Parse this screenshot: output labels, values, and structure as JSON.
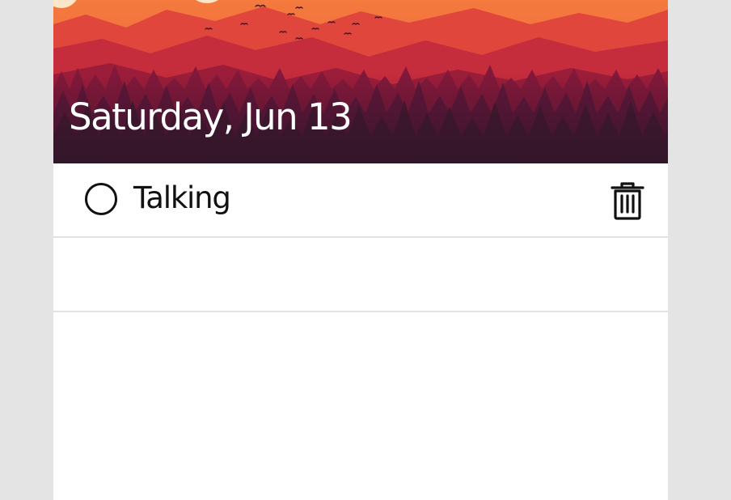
{
  "header": {
    "date": "Saturday, Jun 13",
    "background_scene": "sunset-mountain-forest-landscape",
    "colors": {
      "sky": "#f26a3c",
      "sun": "#fbe6c8",
      "ridge_far": "#e0463c",
      "ridge_mid": "#b8233a",
      "ridge_near": "#86183a",
      "forest_dark": "#3a1a2e"
    }
  },
  "todos": [
    {
      "text": "Talking",
      "completed": false
    }
  ],
  "icons": {
    "checkbox": "empty-circle-icon",
    "delete": "trash-icon"
  }
}
